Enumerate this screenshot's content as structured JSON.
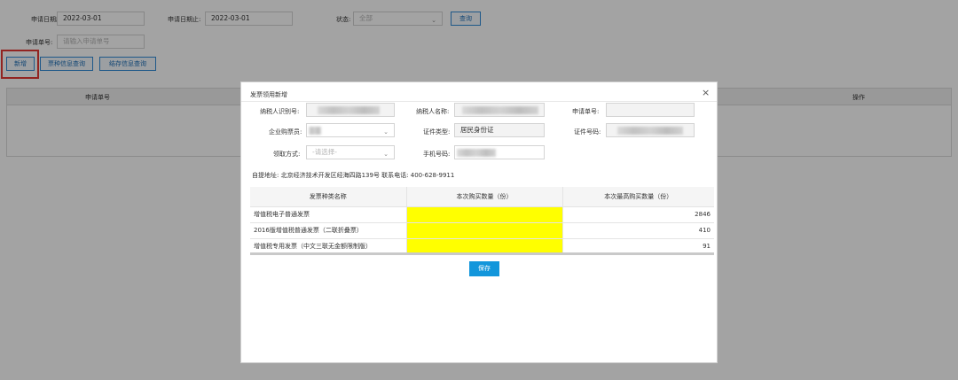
{
  "filters": {
    "start_date_label": "申请日期起:",
    "start_date_value": "2022-03-01",
    "end_date_label": "申请日期止:",
    "end_date_value": "2022-03-01",
    "status_label": "状态:",
    "status_value": "全部",
    "query_button": "查询",
    "apply_no_label": "申请单号:",
    "apply_no_placeholder": "请输入申请单号"
  },
  "toolbar": {
    "add_button": "新增",
    "pickup_query_button": "票种信息查询",
    "stock_query_button": "结存信息查询"
  },
  "bg_table": {
    "col_apply_no": "申请单号",
    "col_action": "操作"
  },
  "modal": {
    "title": "发票领用新增",
    "close_icon": "×",
    "taxpayer_id_label": "纳税人识别号:",
    "taxpayer_name_label": "纳税人名称:",
    "apply_no_label": "申请单号:",
    "buyer_label": "企业购票员:",
    "id_type_label": "证件类型:",
    "id_type_value": "居民身份证",
    "id_no_label": "证件号码:",
    "pickup_method_label": "领取方式:",
    "pickup_method_placeholder": "-请选择-",
    "phone_label": "手机号码:",
    "address_line": "自提地址: 北京经济技术开发区经海四路139号 联系电话: 400-628-9911",
    "table": {
      "headers": [
        "发票种类名称",
        "本次购买数量（份）",
        "本次最高购买数量（份）"
      ],
      "rows": [
        {
          "name": "增值税电子普通发票",
          "qty": "",
          "max": "2846"
        },
        {
          "name": "2016版增值税普通发票（二联折叠票）",
          "qty": "",
          "max": "410"
        },
        {
          "name": "增值税专用发票（中文三联无金额限制版）",
          "qty": "",
          "max": "91"
        }
      ]
    },
    "save_button": "保存"
  },
  "colors": {
    "highlight_box": "#e53935",
    "qty_cell": "#ffff00",
    "primary_button": "#1296db"
  }
}
